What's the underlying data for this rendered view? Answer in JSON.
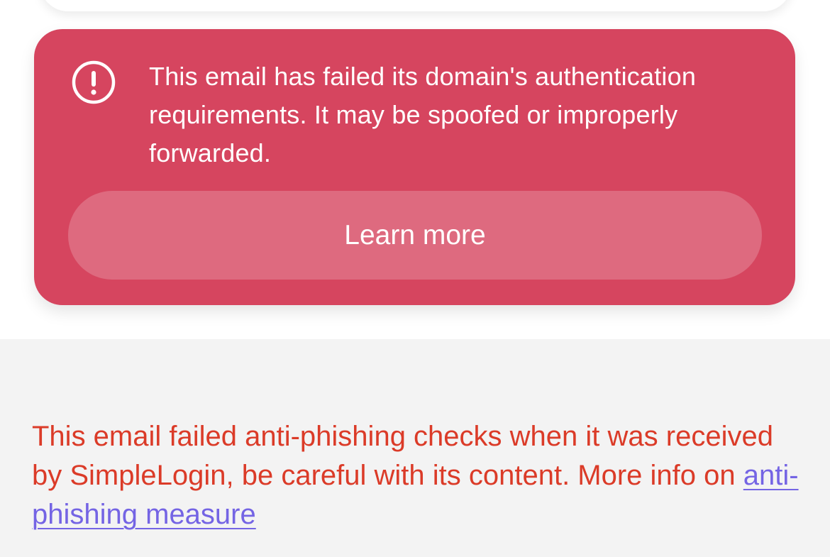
{
  "alert": {
    "icon": "exclamation-circle-icon",
    "message": "This email has failed its domain's authentication requirements. It may be spoofed or improperly forwarded.",
    "button_label": "Learn more",
    "background_color": "#d6455f"
  },
  "footer_warning": {
    "text": "This email failed anti-phishing checks when it was received by SimpleLogin, be careful with its content. More info on ",
    "link_label": "anti-phishing measure",
    "text_color": "#db3b28",
    "link_color": "#7464e4"
  }
}
